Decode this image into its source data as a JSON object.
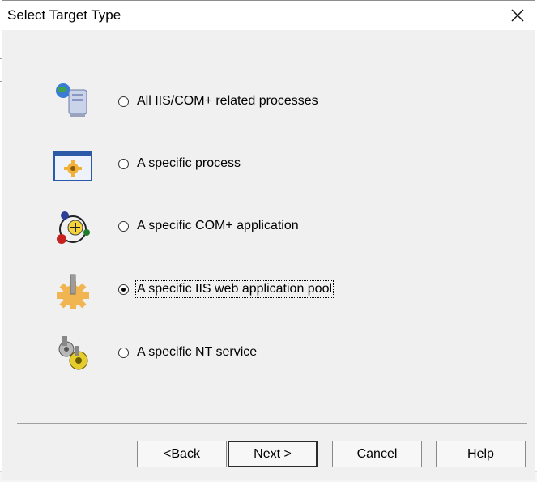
{
  "window": {
    "title": "Select Target Type"
  },
  "options": [
    {
      "label": "All IIS/COM+ related processes",
      "icon": "server-network-icon",
      "selected": false
    },
    {
      "label": "A specific process",
      "icon": "process-window-icon",
      "selected": false
    },
    {
      "label": "A specific COM+ application",
      "icon": "com-plus-icon",
      "selected": false
    },
    {
      "label": "A specific IIS web application pool",
      "icon": "app-pool-gear-icon",
      "selected": true
    },
    {
      "label": "A specific NT service",
      "icon": "service-gears-icon",
      "selected": false
    }
  ],
  "buttons": {
    "back_prefix": "< ",
    "back_mnemonic": "B",
    "back_rest": "ack",
    "next_mnemonic": "N",
    "next_rest": "ext >",
    "cancel": "Cancel",
    "help": "Help"
  }
}
